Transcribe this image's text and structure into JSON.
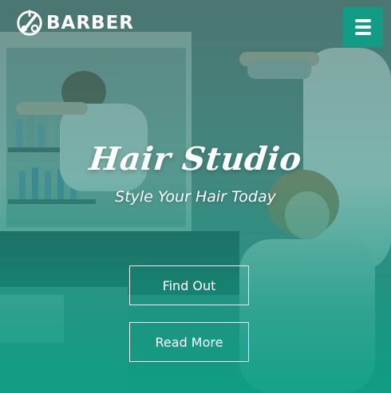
{
  "header": {
    "brand": "BARBER",
    "logo_icon": "barber-scissors-icon",
    "menu_icon": "hamburger-menu-icon",
    "menu_button_color": "#119c86"
  },
  "hero": {
    "title": "Hair Studio",
    "subtitle": "Style Your Hair Today",
    "overlay_color": "#0e9680",
    "buttons": {
      "find_out": "Find Out",
      "read_more": "Read More"
    }
  }
}
